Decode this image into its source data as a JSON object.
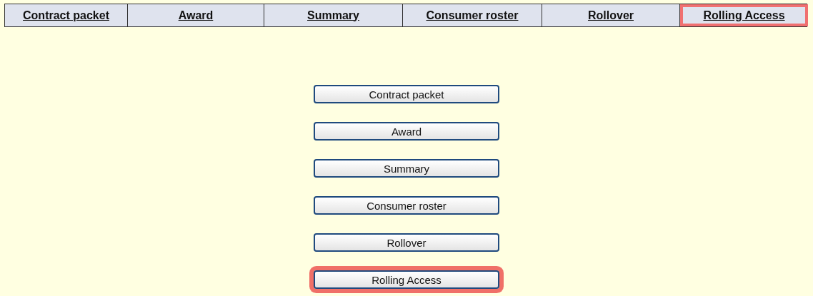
{
  "nav_tabs": [
    {
      "label": "Contract packet",
      "highlighted": false
    },
    {
      "label": "Award",
      "highlighted": false
    },
    {
      "label": "Summary",
      "highlighted": false
    },
    {
      "label": "Consumer roster",
      "highlighted": false
    },
    {
      "label": "Rollover",
      "highlighted": false
    },
    {
      "label": "Rolling Access",
      "highlighted": true
    }
  ],
  "buttons": [
    {
      "label": "Contract packet",
      "highlighted": false
    },
    {
      "label": "Award",
      "highlighted": false
    },
    {
      "label": "Summary",
      "highlighted": false
    },
    {
      "label": "Consumer roster",
      "highlighted": false
    },
    {
      "label": "Rollover",
      "highlighted": false
    },
    {
      "label": "Rolling Access",
      "highlighted": true
    }
  ]
}
